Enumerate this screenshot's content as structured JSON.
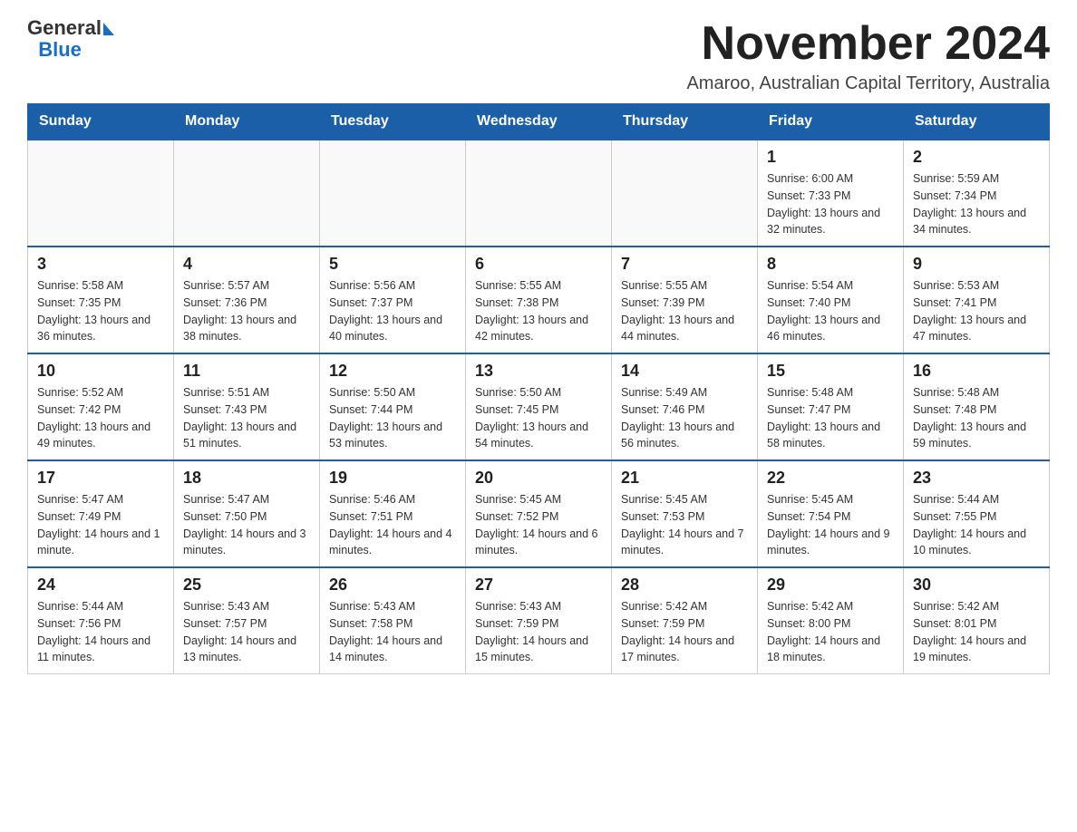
{
  "header": {
    "logo_text_general": "General",
    "logo_text_blue": "Blue",
    "title": "November 2024",
    "subtitle": "Amaroo, Australian Capital Territory, Australia"
  },
  "calendar": {
    "days_of_week": [
      "Sunday",
      "Monday",
      "Tuesday",
      "Wednesday",
      "Thursday",
      "Friday",
      "Saturday"
    ],
    "weeks": [
      [
        {
          "day": "",
          "info": ""
        },
        {
          "day": "",
          "info": ""
        },
        {
          "day": "",
          "info": ""
        },
        {
          "day": "",
          "info": ""
        },
        {
          "day": "",
          "info": ""
        },
        {
          "day": "1",
          "info": "Sunrise: 6:00 AM\nSunset: 7:33 PM\nDaylight: 13 hours and 32 minutes."
        },
        {
          "day": "2",
          "info": "Sunrise: 5:59 AM\nSunset: 7:34 PM\nDaylight: 13 hours and 34 minutes."
        }
      ],
      [
        {
          "day": "3",
          "info": "Sunrise: 5:58 AM\nSunset: 7:35 PM\nDaylight: 13 hours and 36 minutes."
        },
        {
          "day": "4",
          "info": "Sunrise: 5:57 AM\nSunset: 7:36 PM\nDaylight: 13 hours and 38 minutes."
        },
        {
          "day": "5",
          "info": "Sunrise: 5:56 AM\nSunset: 7:37 PM\nDaylight: 13 hours and 40 minutes."
        },
        {
          "day": "6",
          "info": "Sunrise: 5:55 AM\nSunset: 7:38 PM\nDaylight: 13 hours and 42 minutes."
        },
        {
          "day": "7",
          "info": "Sunrise: 5:55 AM\nSunset: 7:39 PM\nDaylight: 13 hours and 44 minutes."
        },
        {
          "day": "8",
          "info": "Sunrise: 5:54 AM\nSunset: 7:40 PM\nDaylight: 13 hours and 46 minutes."
        },
        {
          "day": "9",
          "info": "Sunrise: 5:53 AM\nSunset: 7:41 PM\nDaylight: 13 hours and 47 minutes."
        }
      ],
      [
        {
          "day": "10",
          "info": "Sunrise: 5:52 AM\nSunset: 7:42 PM\nDaylight: 13 hours and 49 minutes."
        },
        {
          "day": "11",
          "info": "Sunrise: 5:51 AM\nSunset: 7:43 PM\nDaylight: 13 hours and 51 minutes."
        },
        {
          "day": "12",
          "info": "Sunrise: 5:50 AM\nSunset: 7:44 PM\nDaylight: 13 hours and 53 minutes."
        },
        {
          "day": "13",
          "info": "Sunrise: 5:50 AM\nSunset: 7:45 PM\nDaylight: 13 hours and 54 minutes."
        },
        {
          "day": "14",
          "info": "Sunrise: 5:49 AM\nSunset: 7:46 PM\nDaylight: 13 hours and 56 minutes."
        },
        {
          "day": "15",
          "info": "Sunrise: 5:48 AM\nSunset: 7:47 PM\nDaylight: 13 hours and 58 minutes."
        },
        {
          "day": "16",
          "info": "Sunrise: 5:48 AM\nSunset: 7:48 PM\nDaylight: 13 hours and 59 minutes."
        }
      ],
      [
        {
          "day": "17",
          "info": "Sunrise: 5:47 AM\nSunset: 7:49 PM\nDaylight: 14 hours and 1 minute."
        },
        {
          "day": "18",
          "info": "Sunrise: 5:47 AM\nSunset: 7:50 PM\nDaylight: 14 hours and 3 minutes."
        },
        {
          "day": "19",
          "info": "Sunrise: 5:46 AM\nSunset: 7:51 PM\nDaylight: 14 hours and 4 minutes."
        },
        {
          "day": "20",
          "info": "Sunrise: 5:45 AM\nSunset: 7:52 PM\nDaylight: 14 hours and 6 minutes."
        },
        {
          "day": "21",
          "info": "Sunrise: 5:45 AM\nSunset: 7:53 PM\nDaylight: 14 hours and 7 minutes."
        },
        {
          "day": "22",
          "info": "Sunrise: 5:45 AM\nSunset: 7:54 PM\nDaylight: 14 hours and 9 minutes."
        },
        {
          "day": "23",
          "info": "Sunrise: 5:44 AM\nSunset: 7:55 PM\nDaylight: 14 hours and 10 minutes."
        }
      ],
      [
        {
          "day": "24",
          "info": "Sunrise: 5:44 AM\nSunset: 7:56 PM\nDaylight: 14 hours and 11 minutes."
        },
        {
          "day": "25",
          "info": "Sunrise: 5:43 AM\nSunset: 7:57 PM\nDaylight: 14 hours and 13 minutes."
        },
        {
          "day": "26",
          "info": "Sunrise: 5:43 AM\nSunset: 7:58 PM\nDaylight: 14 hours and 14 minutes."
        },
        {
          "day": "27",
          "info": "Sunrise: 5:43 AM\nSunset: 7:59 PM\nDaylight: 14 hours and 15 minutes."
        },
        {
          "day": "28",
          "info": "Sunrise: 5:42 AM\nSunset: 7:59 PM\nDaylight: 14 hours and 17 minutes."
        },
        {
          "day": "29",
          "info": "Sunrise: 5:42 AM\nSunset: 8:00 PM\nDaylight: 14 hours and 18 minutes."
        },
        {
          "day": "30",
          "info": "Sunrise: 5:42 AM\nSunset: 8:01 PM\nDaylight: 14 hours and 19 minutes."
        }
      ]
    ]
  }
}
